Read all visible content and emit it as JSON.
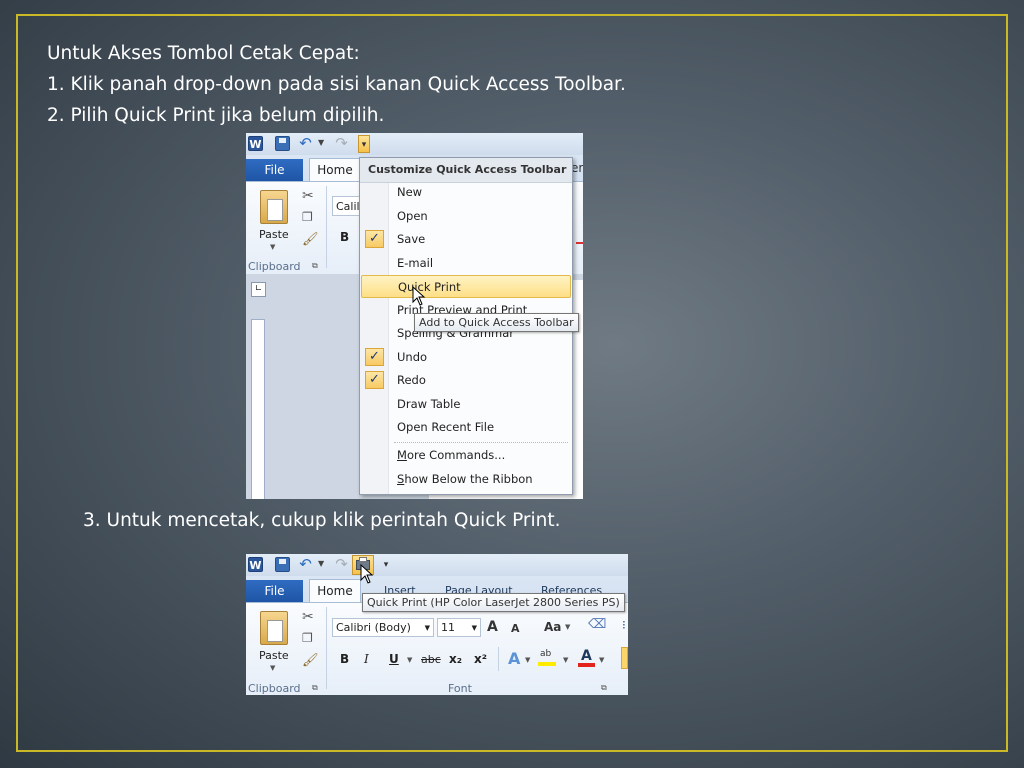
{
  "slide": {
    "line1": "Untuk Akses Tombol Cetak Cepat:",
    "line2": "1. Klik panah drop-down pada sisi kanan Quick Access Toolbar.",
    "line3": "2. Pilih Quick Print jika belum dipilih.",
    "step3": "3. Untuk mencetak, cukup klik perintah Quick Print."
  },
  "shot1": {
    "file_tab": "File",
    "home_tab": "Home",
    "font_partial": "Calil",
    "bold": "B",
    "paste_label": "Paste",
    "group_clipboard": "Clipboard",
    "menu": {
      "header": "Customize Quick Access Toolbar",
      "items": [
        {
          "label": "New",
          "checked": false
        },
        {
          "label": "Open",
          "checked": false
        },
        {
          "label": "Save",
          "checked": true
        },
        {
          "label": "E-mail",
          "checked": false
        },
        {
          "label": "Quick Print",
          "checked": false,
          "highlighted": true
        },
        {
          "label": "Print Preview and Print",
          "checked": false
        },
        {
          "label": "Spelling & Grammar",
          "checked": false
        },
        {
          "label": "Undo",
          "checked": true
        },
        {
          "label": "Redo",
          "checked": true
        },
        {
          "label": "Draw Table",
          "checked": false
        },
        {
          "label": "Open Recent File",
          "checked": false
        },
        {
          "label_prefix": "",
          "label_underline": "M",
          "label_rest": "ore Commands..."
        },
        {
          "label_prefix": "",
          "label_underline": "S",
          "label_rest": "how Below the Ribbon"
        }
      ],
      "check_glyph": "✓"
    },
    "tooltip": "Add to Quick Access Toolbar"
  },
  "shot2": {
    "file_tab": "File",
    "home_tab": "Home",
    "tab_insert": "Insert",
    "tab_page_layout": "Page Layout",
    "tab_references": "References",
    "tooltip": "Quick Print (HP Color LaserJet 2800 Series PS)",
    "font_name": "Calibri (Body)",
    "font_size": "11",
    "paste_label": "Paste",
    "group_clipboard": "Clipboard",
    "group_font": "Font",
    "fmt": {
      "bold": "B",
      "italic": "I",
      "underline": "U",
      "strike": "abc",
      "sub": "x₂",
      "sup": "x²",
      "grow": "A",
      "shrink": "A",
      "case": "Aa"
    }
  },
  "colors": {
    "frame": "#c9b927",
    "accent_blue": "#2b579a",
    "highlight": "#fddf86"
  }
}
